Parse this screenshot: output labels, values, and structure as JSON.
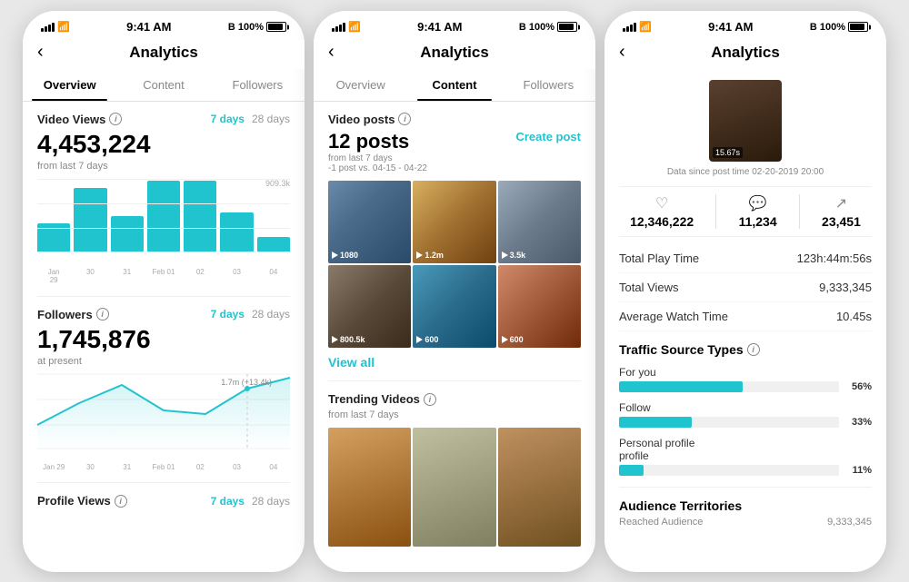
{
  "phone1": {
    "statusBar": {
      "time": "9:41 AM",
      "battery": "100%"
    },
    "header": {
      "title": "Analytics",
      "back": "‹"
    },
    "tabs": [
      {
        "label": "Overview",
        "active": true
      },
      {
        "label": "Content",
        "active": false
      },
      {
        "label": "Followers",
        "active": false
      }
    ],
    "videoViews": {
      "sectionTitle": "Video Views",
      "filter1": "7 days",
      "filter2": "28 days",
      "value": "4,453,224",
      "sublabel": "from last 7 days",
      "chartMax": "909.3k",
      "bars": [
        40,
        90,
        50,
        100,
        100,
        55,
        20
      ],
      "xLabels": [
        "Jan\n29",
        "30",
        "31",
        "Feb 01",
        "02",
        "03",
        "04"
      ]
    },
    "followers": {
      "sectionTitle": "Followers",
      "filter1": "7 days",
      "filter2": "28 days",
      "value": "1,745,876",
      "sublabel": "at present",
      "tooltipLabel": "1.7m (+13.4k)",
      "linePoints": [
        30,
        60,
        85,
        50,
        45,
        80,
        95
      ],
      "xLabels": [
        "Jan 29",
        "30",
        "31",
        "Feb 01",
        "02",
        "03",
        "04"
      ]
    },
    "profileViews": {
      "sectionTitle": "Profile Views",
      "filter1": "7 days",
      "filter2": "28 days"
    }
  },
  "phone2": {
    "statusBar": {
      "time": "9:41 AM",
      "battery": "100%"
    },
    "header": {
      "title": "Analytics",
      "back": "‹"
    },
    "tabs": [
      {
        "label": "Overview",
        "active": false
      },
      {
        "label": "Content",
        "active": true
      },
      {
        "label": "Followers",
        "active": false
      }
    ],
    "videoPosts": {
      "sectionTitle": "Video posts",
      "postsCount": "12 posts",
      "sublabel": "from last 7 days",
      "sublabel2": "-1 post vs. 04-15 - 04-22",
      "createBtn": "Create post",
      "videos": [
        {
          "label": "1080",
          "color1": "#5a7a8a",
          "color2": "#4a6a7a"
        },
        {
          "label": "1.2m",
          "color1": "#c8a050",
          "color2": "#a07030"
        },
        {
          "label": "3.5k",
          "color1": "#7a8a9a",
          "color2": "#6a7a8a"
        },
        {
          "label": "800.5k",
          "color1": "#6a5a4a",
          "color2": "#5a4a3a"
        },
        {
          "label": "600",
          "color1": "#3a7a9a",
          "color2": "#2a6a8a"
        },
        {
          "label": "600",
          "color1": "#b06a4a",
          "color2": "#905a3a"
        }
      ],
      "viewAll": "View all"
    },
    "trendingVideos": {
      "sectionTitle": "Trending Videos",
      "sublabel": "from last 7 days",
      "videos": [
        {
          "color1": "#c8a050",
          "color2": "#a07030"
        },
        {
          "color1": "#b8b8a0",
          "color2": "#989880"
        },
        {
          "color1": "#c09060",
          "color2": "#a07040"
        }
      ]
    }
  },
  "phone3": {
    "statusBar": {
      "time": "9:41 AM",
      "battery": "100%"
    },
    "header": {
      "title": "Analytics",
      "back": "‹"
    },
    "videoPreview": {
      "overlay": "15.67s",
      "dataSince": "Data since post time 02-20-2019 20:00"
    },
    "stats": {
      "likes": "12,346,222",
      "comments": "11,234",
      "shares": "23,451"
    },
    "details": [
      {
        "label": "Total Play Time",
        "value": "123h:44m:56s"
      },
      {
        "label": "Total Views",
        "value": "9,333,345"
      },
      {
        "label": "Average Watch Time",
        "value": "10.45s"
      }
    ],
    "trafficSources": {
      "title": "Traffic Source Types",
      "items": [
        {
          "label": "For you",
          "pct": 56,
          "display": "56%"
        },
        {
          "label": "Follow",
          "pct": 33,
          "display": "33%"
        },
        {
          "label": "Personal profile\nprofile",
          "pct": 11,
          "display": "11%"
        }
      ]
    },
    "audienceSection": {
      "title": "Audience Territories",
      "reachedLabel": "Reached Audience",
      "reachedValue": "9,333,345"
    }
  },
  "icons": {
    "back": "‹",
    "info": "i",
    "heart": "♡",
    "comment": "💬",
    "share": "↗"
  }
}
